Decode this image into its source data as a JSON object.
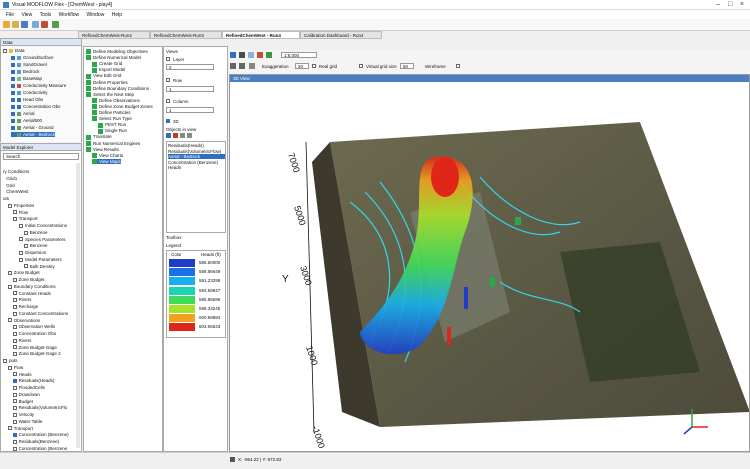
{
  "window": {
    "title": "Visual MODFLOW Flex - [ChemWest - play4]"
  },
  "menu": [
    "File",
    "View",
    "Tools",
    "Workflow",
    "Window",
    "Help"
  ],
  "tabs": [
    "RefinedChemWest-Run2",
    "RefinedChemWest-Run3",
    "RefinedChemWest - Run4",
    "Calibration Dashboard - Run4"
  ],
  "data_panel": {
    "title": "Data",
    "items": [
      {
        "label": "Data"
      },
      {
        "label": "GroundSurface"
      },
      {
        "label": "SandGravel"
      },
      {
        "label": "Bedrock"
      },
      {
        "label": "BaseMap"
      },
      {
        "label": "Conductivity Measure"
      },
      {
        "label": "Conductivity"
      },
      {
        "label": "Head Obs"
      },
      {
        "label": "Concentration Obs"
      },
      {
        "label": "Aerial"
      },
      {
        "label": "Aerial500"
      },
      {
        "label": "Aerial - Ground"
      },
      {
        "label": "Aerial - Bedrock"
      }
    ]
  },
  "model_explorer": {
    "title": "Model Explorer",
    "search": "Search",
    "items": [
      {
        "label": "ry Conditions"
      },
      {
        "label": "Grid1"
      },
      {
        "label": "Grid"
      },
      {
        "label": "ChemWest"
      },
      {
        "label": "uts"
      },
      {
        "label": "Properties"
      },
      {
        "label": "Flow"
      },
      {
        "label": "Transport"
      },
      {
        "label": "Initial Concentrations"
      },
      {
        "label": "Benzene"
      },
      {
        "label": "Species Parameters"
      },
      {
        "label": "Benzene"
      },
      {
        "label": "Dispersion"
      },
      {
        "label": "Model Parameters"
      },
      {
        "label": "Bulk Density"
      },
      {
        "label": "Zone Budget"
      },
      {
        "label": "Zone Budget"
      },
      {
        "label": "Boundary Conditions"
      },
      {
        "label": "Constant Heads"
      },
      {
        "label": "Rivers"
      },
      {
        "label": "Recharge"
      },
      {
        "label": "Constant Concentrations"
      },
      {
        "label": "Observations"
      },
      {
        "label": "Observation Wells"
      },
      {
        "label": "Concentration Obs"
      },
      {
        "label": "Rivers"
      },
      {
        "label": "Zone Budget-Gage"
      },
      {
        "label": "Zone Budget-Gage 2"
      },
      {
        "label": "puts"
      },
      {
        "label": "Flow"
      },
      {
        "label": "Heads"
      },
      {
        "label": "Residuals(Heads)"
      },
      {
        "label": "FloodedCells"
      },
      {
        "label": "Drawdown"
      },
      {
        "label": "Budget"
      },
      {
        "label": "Residuals(VolumetricFlo"
      },
      {
        "label": "Velocity"
      },
      {
        "label": "Water Table"
      },
      {
        "label": "Transport"
      },
      {
        "label": "Concentration (Benzene)"
      },
      {
        "label": "Residuals(Benzene)"
      },
      {
        "label": "Concentration (Benzene"
      }
    ]
  },
  "workflow": {
    "items": [
      {
        "label": "Define Modeling Objectives"
      },
      {
        "label": "Define Numerical Model"
      },
      {
        "label": "Create Grid"
      },
      {
        "label": "Import Model"
      },
      {
        "label": "View Edit Grid"
      },
      {
        "label": "Define Properties"
      },
      {
        "label": "Define Boundary Conditions"
      },
      {
        "label": "Select the Next Step"
      },
      {
        "label": "Define Observations"
      },
      {
        "label": "Define Zone Budget Zones"
      },
      {
        "label": "Define Particles"
      },
      {
        "label": "Select Run Type"
      },
      {
        "label": "PEST Run"
      },
      {
        "label": "Single Run"
      },
      {
        "label": "Translate"
      },
      {
        "label": "Run Numerical Engines"
      },
      {
        "label": "View Results"
      },
      {
        "label": "View Charts"
      },
      {
        "label": "View Maps"
      }
    ]
  },
  "views_panel": {
    "title": "Views",
    "layer_label": "Layer",
    "layer_value": "2",
    "row_label": "Row",
    "row_value": "1",
    "column_label": "Column",
    "column_value": "1",
    "threed_label": "3D",
    "objects_title": "Objects in view",
    "objects": [
      "Residuals(Heads)",
      "Residuals(VolumetricFlow)",
      "Aerial - Bedrock",
      "Concentration (Benzene)",
      "Heads"
    ],
    "toolbox_title": "Toolbox",
    "legend_title": "Legend",
    "legend_header_color": "Color",
    "legend_header_value": "Heads (ft)",
    "legend": [
      {
        "value": "586.50000",
        "color": "#1f3dc8"
      },
      {
        "value": "588.86649",
        "color": "#1c6fe6"
      },
      {
        "value": "591.23298",
        "color": "#16b0ef"
      },
      {
        "value": "593.59947",
        "color": "#1ad6b0"
      },
      {
        "value": "595.96596",
        "color": "#3fdc5a"
      },
      {
        "value": "598.33245",
        "color": "#a7e22a"
      },
      {
        "value": "600.69894",
        "color": "#f0a21e"
      },
      {
        "value": "603.06543",
        "color": "#e02618"
      }
    ]
  },
  "view_toolbar": {
    "scale": "1:5,000",
    "exaggeration_label": "Exaggeration",
    "exaggeration_value": "20",
    "real_grid_label": "Real grid",
    "virtual_grid_label": "Virtual grid size",
    "virtual_grid_value": "50",
    "wireframe_label": "Wireframe"
  },
  "view3d": {
    "title": "3D View",
    "y_axis_label": "Y",
    "y_ticks": [
      "7000",
      "5000",
      "3000",
      "1000",
      "-1000"
    ]
  },
  "status": {
    "coords": "X: -964.22  |  Y: 972.83"
  }
}
